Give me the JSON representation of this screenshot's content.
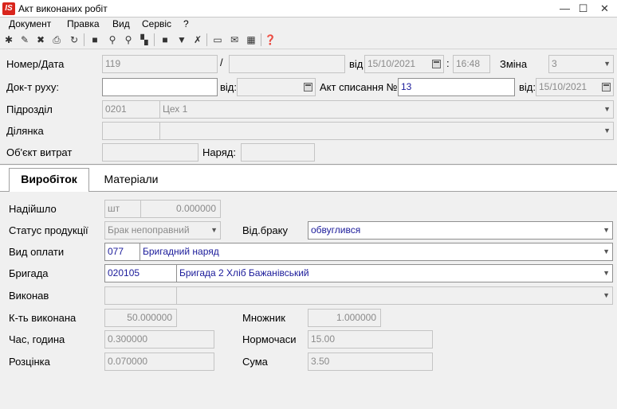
{
  "window": {
    "title": "Акт виконаних робіт",
    "app_icon_text": "IS",
    "minimize": "—",
    "maximize": "☐",
    "close": "✕"
  },
  "menu": [
    "Документ",
    "Правка",
    "Вид",
    "Сервіс",
    "?"
  ],
  "header": {
    "number_label": "Номер/Дата",
    "number_value": "119",
    "slash": "/",
    "suffix_value": "",
    "from_label": "від",
    "date_value": "15/10/2021",
    "colon": ":",
    "time_value": "16:48",
    "shift_label": "Зміна",
    "shift_value": "3",
    "move_doc_label": "Док-т руху:",
    "move_doc_value": "",
    "move_from_label": "від:",
    "move_date_value": "",
    "writeoff_label": "Акт списання №",
    "writeoff_value": "13",
    "writeoff_from_label": "від:",
    "writeoff_date_value": "15/10/2021",
    "division_label": "Підрозділ",
    "division_code": "0201",
    "division_name": "Цех 1",
    "section_label": "Ділянка",
    "section_code": "",
    "section_name": "",
    "cost_label": "Об'єкт витрат",
    "cost_value": "",
    "order_label": "Наряд:",
    "order_value": ""
  },
  "tabs": [
    {
      "label": "Виробіток",
      "active": true
    },
    {
      "label": "Матеріали",
      "active": false
    }
  ],
  "production": {
    "received_label": "Надійшло",
    "unit_value": "шт",
    "received_value": "0.000000",
    "status_label": "Статус продукції",
    "status_value": "Брак непоправний",
    "defect_label": "Від.браку",
    "defect_value": "обвуглився",
    "pay_label": "Вид оплати",
    "pay_code": "077",
    "pay_name": "Бригадний наряд",
    "brigade_label": "Бригада",
    "brigade_code": "020105",
    "brigade_name": "Бригада 2 Хліб Бажанівський",
    "done_label": "Виконав",
    "done_code": "",
    "done_name": "",
    "qty_label": "К-ть виконана",
    "qty_value": "50.000000",
    "mult_label": "Множник",
    "mult_value": "1.000000",
    "hours_label": "Час, година",
    "hours_value": "0.300000",
    "norm_label": "Нормочаси",
    "norm_value": "15.00",
    "rate_label": "Розцінка",
    "rate_value": "0.070000",
    "sum_label": "Сума",
    "sum_value": "3.50"
  }
}
